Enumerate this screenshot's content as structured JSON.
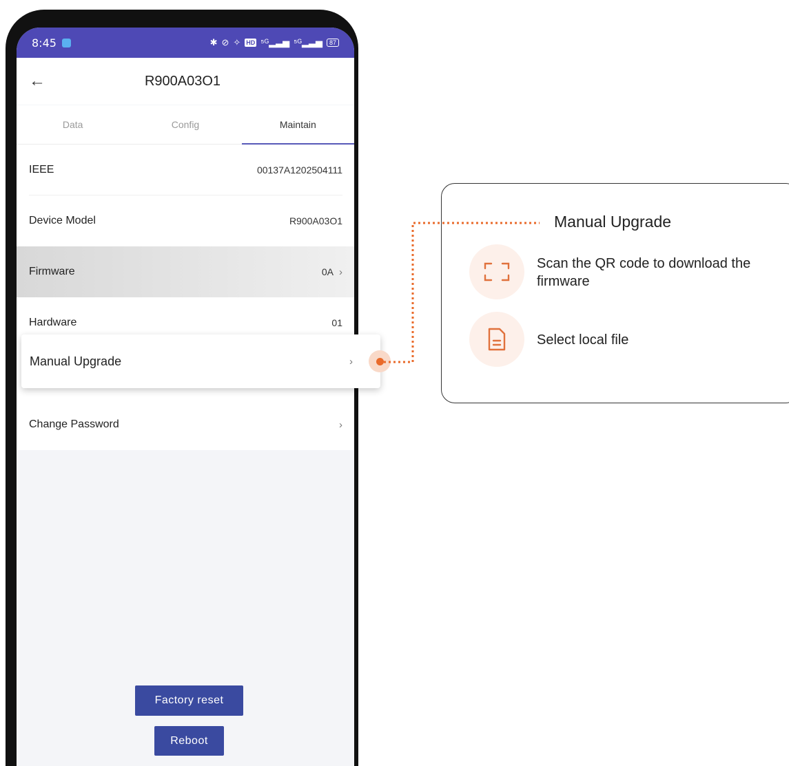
{
  "statusbar": {
    "time": "8:45",
    "icons": [
      "bluetooth-icon",
      "link-icon",
      "vibrate-off-icon",
      "hd-icon",
      "signal-5g-icon",
      "signal-5g-icon",
      "battery-icon"
    ],
    "hd_label": "HD",
    "signal_1": "⁵ᴳ",
    "signal_2": "⁵ᴳ",
    "battery": "87"
  },
  "appbar": {
    "back_icon": "back-arrow-icon",
    "title": "R900A03O1"
  },
  "tabs": [
    {
      "label": "Data",
      "active": false
    },
    {
      "label": "Config",
      "active": false
    },
    {
      "label": "Maintain",
      "active": true
    }
  ],
  "list": {
    "ieee": {
      "label": "IEEE",
      "value": "00137A1202504111"
    },
    "device_model": {
      "label": "Device Model",
      "value": "R900A03O1"
    },
    "firmware": {
      "label": "Firmware",
      "value": "0A"
    },
    "hardware": {
      "label": "Hardware",
      "value": "01"
    },
    "manual_upgrade": {
      "label": "Manual Upgrade"
    },
    "change_password": {
      "label": "Change Password"
    }
  },
  "buttons": {
    "factory_reset": "Factory reset",
    "reboot": "Reboot"
  },
  "callout": {
    "title": "Manual Upgrade",
    "options": [
      {
        "icon": "scan-qr-icon",
        "text": "Scan the QR code to download the firmware"
      },
      {
        "icon": "file-icon",
        "text": "Select local file"
      }
    ]
  },
  "colors": {
    "status_bar": "#4e49b5",
    "tab_indicator": "#5659b8",
    "button": "#3a4aa0",
    "accent": "#e96a2a",
    "accent_light": "#fdf0ea"
  }
}
